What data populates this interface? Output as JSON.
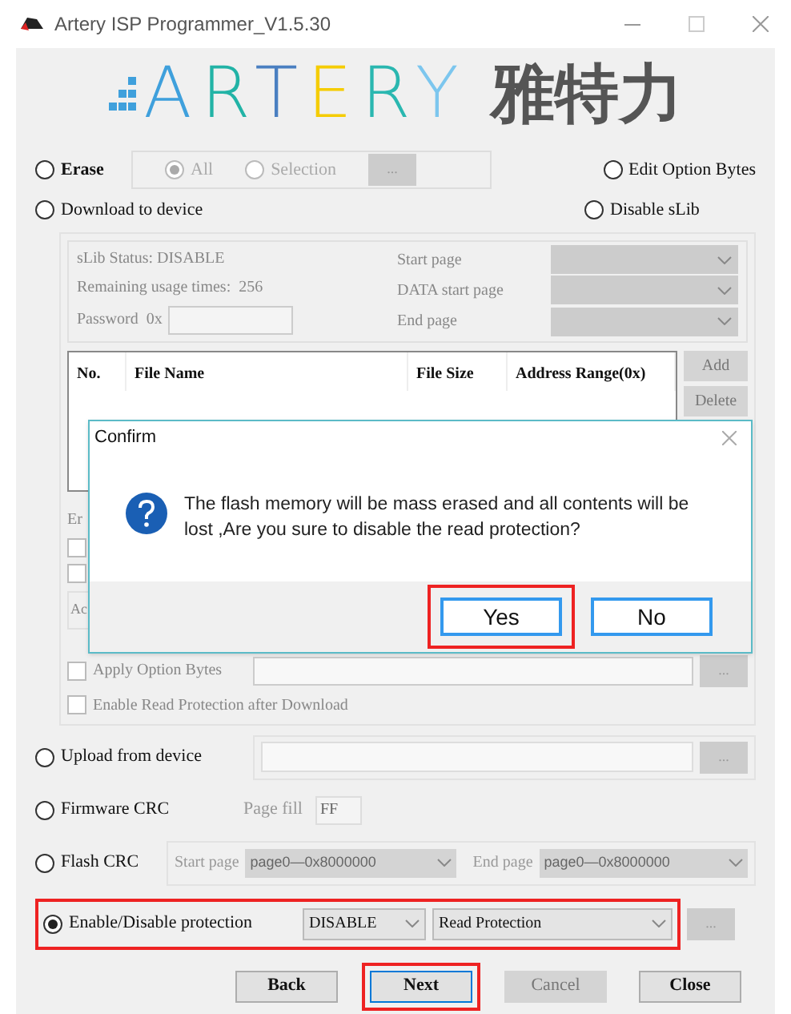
{
  "window": {
    "title": "Artery ISP Programmer_V1.5.30"
  },
  "logo": {
    "text": "ARTERY",
    "text_cn": "雅特力"
  },
  "erase": {
    "label": "Erase",
    "selected": false,
    "options": [
      {
        "label": "All",
        "selected": true
      },
      {
        "label": "Selection",
        "selected": false
      }
    ],
    "browse": "..."
  },
  "right_options": [
    {
      "label": "Edit Option Bytes",
      "selected": false
    },
    {
      "label": "Disable sLib",
      "selected": false
    }
  ],
  "download": {
    "label": "Download to device",
    "selected": false
  },
  "slib": {
    "status": "sLib Status: DISABLE",
    "remaining": "Remaining usage times:  256",
    "password_label": "Password  0x",
    "pages": [
      {
        "label": "Start page"
      },
      {
        "label": "DATA start page"
      },
      {
        "label": "End page"
      }
    ]
  },
  "file_table": {
    "columns": [
      "No.",
      "File Name",
      "File Size",
      "Address Range(0x)"
    ],
    "buttons": [
      "Add",
      "Delete"
    ]
  },
  "download_options": {
    "erase_label": "Er",
    "address_label": "Ac",
    "checkboxes": [
      {
        "checked": false
      },
      {
        "checked": false
      }
    ],
    "apply_option_bytes": {
      "label": "Apply Option Bytes",
      "checked": false,
      "browse": "..."
    },
    "read_protect": {
      "label": "Enable Read Protection after Download",
      "checked": false
    }
  },
  "upload": {
    "label": "Upload from device",
    "selected": false,
    "browse": "..."
  },
  "firmware_crc": {
    "label": "Firmware CRC",
    "selected": false,
    "page_fill_label": "Page fill",
    "page_fill": "FF"
  },
  "flash_crc": {
    "label": "Flash CRC",
    "selected": false,
    "start_label": "Start page",
    "start_value": "page0—0x8000000",
    "end_label": "End page",
    "end_value": "page0—0x8000000"
  },
  "protection": {
    "label": "Enable/Disable protection",
    "selected": true,
    "highlighted": true,
    "mode": "DISABLE",
    "type": "Read Protection",
    "browse": "..."
  },
  "buttons": [
    {
      "label": "Back",
      "kind": "normal",
      "highlighted": false
    },
    {
      "label": "Next",
      "kind": "default",
      "highlighted": true
    },
    {
      "label": "Cancel",
      "kind": "disabled",
      "highlighted": false
    },
    {
      "label": "Close",
      "kind": "normal",
      "highlighted": false
    }
  ],
  "dialog": {
    "title": "Confirm",
    "message": "The flash memory will be mass erased and all contents will be lost ,Are you sure to disable the read protection?",
    "buttons": [
      {
        "label": "Yes",
        "highlighted": true
      },
      {
        "label": "No",
        "highlighted": false
      }
    ]
  }
}
